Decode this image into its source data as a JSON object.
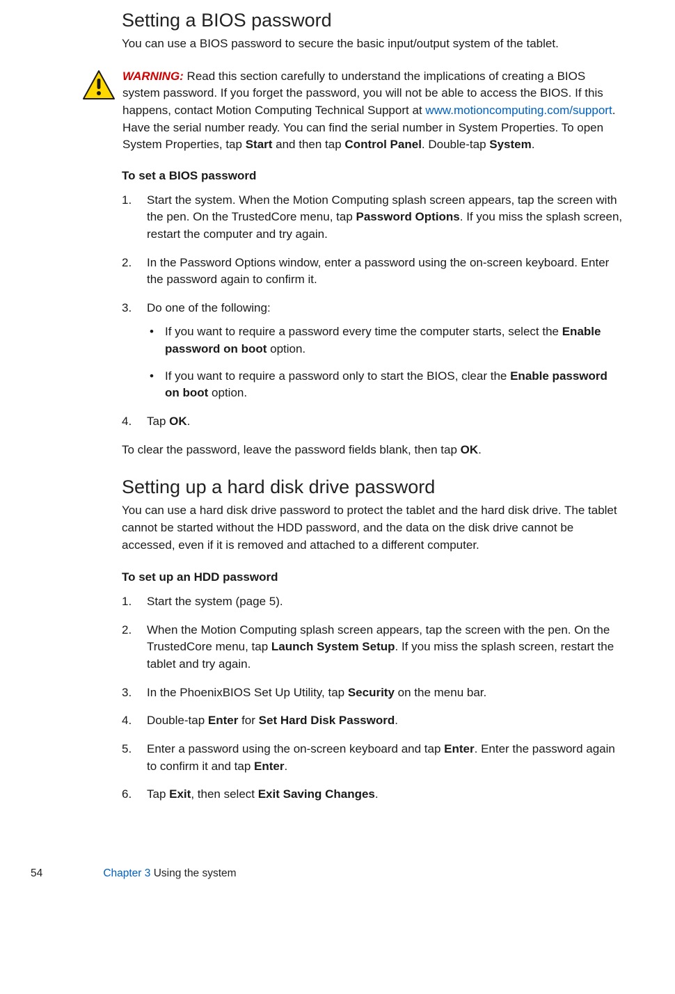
{
  "section1": {
    "heading": "Setting a BIOS password",
    "intro": "You can use a BIOS password to secure the basic input/output system of the tablet."
  },
  "warning": {
    "label": "WARNING:",
    "text_before_link": " Read this section carefully to understand the implications of creating a BIOS system password. If you forget the password, you will not be able to access the BIOS. If this happens, contact Motion Computing Technical Support at ",
    "link": "www.motioncomputing.com/support",
    "text_after_link_1": ". Have the serial number ready. You can find the serial number in System Properties. To open System Properties, tap ",
    "bold_start": "Start",
    "mid1": " and then tap ",
    "bold_cp": "Control Panel",
    "mid2": ". Double-tap ",
    "bold_system": "System",
    "tail": "."
  },
  "proc1": {
    "heading": "To set a BIOS password",
    "step1_a": "Start the system. When the Motion Computing splash screen appears, tap the screen with the pen. On the TrustedCore menu, tap ",
    "step1_b_bold": "Password Options",
    "step1_c": ". If you miss the splash screen, restart the computer and try again.",
    "step2": "In the Password Options window, enter a password using the on-screen keyboard. Enter the password again to confirm it.",
    "step3": "Do one of the following:",
    "bullet1_a": "If you want to require a password every time the computer starts, select the ",
    "bullet1_b_bold": "Enable password on boot",
    "bullet1_c": " option.",
    "bullet2_a": "If you want to require a password only to start the BIOS, clear the ",
    "bullet2_b_bold": "Enable password on boot",
    "bullet2_c": " option.",
    "step4_a": "Tap ",
    "step4_b_bold": "OK",
    "step4_c": ".",
    "after_a": "To clear the password, leave the password fields blank, then tap ",
    "after_b_bold": "OK",
    "after_c": "."
  },
  "section2": {
    "heading": "Setting up a hard disk drive password",
    "intro": "You can use a hard disk drive password to protect the tablet and the hard disk drive. The tablet cannot be started without the HDD password, and the data on the disk drive cannot be accessed, even if it is removed and attached to a different computer."
  },
  "proc2": {
    "heading": "To set up an HDD password",
    "step1": "Start the system (page 5).",
    "step2_a": "When the Motion Computing splash screen appears, tap the screen with the pen. On the TrustedCore menu, tap ",
    "step2_b_bold": "Launch System Setup",
    "step2_c": ". If you miss the splash screen, restart the tablet and try again.",
    "step3_a": "In the PhoenixBIOS Set Up Utility, tap ",
    "step3_b_bold": "Security",
    "step3_c": " on the menu bar.",
    "step4_a": "Double-tap ",
    "step4_b_bold": "Enter",
    "step4_c": " for ",
    "step4_d_bold": "Set Hard Disk Password",
    "step4_e": ".",
    "step5_a": "Enter a password using the on-screen keyboard and tap ",
    "step5_b_bold": "Enter",
    "step5_c": ". Enter the password again to confirm it and tap ",
    "step5_d_bold": "Enter",
    "step5_e": ".",
    "step6_a": "Tap ",
    "step6_b_bold": "Exit",
    "step6_c": ", then select ",
    "step6_d_bold": "Exit Saving Changes",
    "step6_e": "."
  },
  "footer": {
    "page_number": "54",
    "chapter_ref": "Chapter 3",
    "chapter_title": "  Using the system"
  }
}
